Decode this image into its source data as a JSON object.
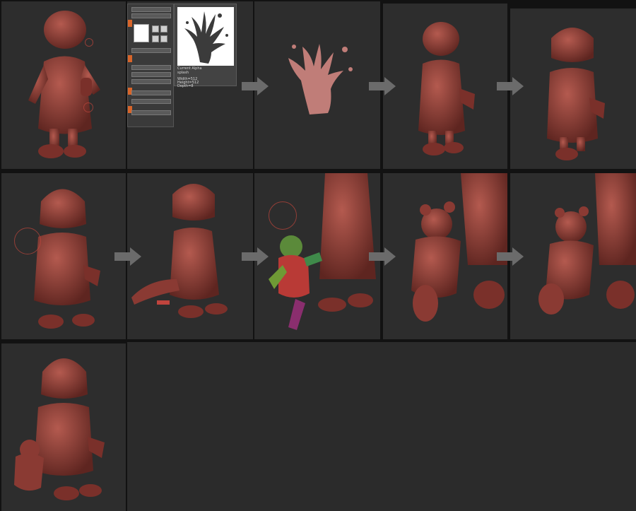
{
  "alpha_popup": {
    "title": "Current Alpha",
    "name": "splash",
    "width_label": "Width=512",
    "height_label": "Height=512",
    "depth_label": "Depth=8"
  },
  "colors": {
    "background": "#2d2d2d",
    "clay": "#8a3a33",
    "clay_highlight": "#b0564c",
    "arrow": "#6b6b6b",
    "brush_ring": "#be463c",
    "palette_accent": "#d8652a"
  },
  "icons": [
    "next-step-arrow-icon",
    "brush-cursor-ring-icon",
    "alpha-splash-icon"
  ]
}
